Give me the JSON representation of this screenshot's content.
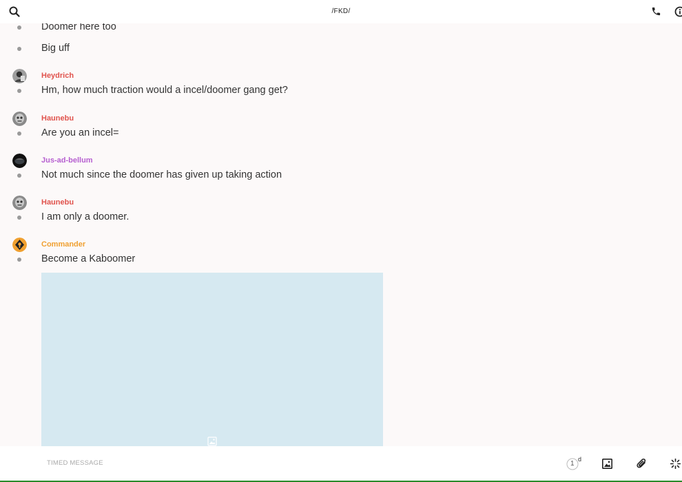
{
  "header": {
    "title": "/FKD/"
  },
  "messages": [
    {
      "author": "",
      "text": "Doomer here too"
    },
    {
      "author": "",
      "text": "Big uff"
    },
    {
      "author": "Heydrich",
      "author_color": "#e0524c",
      "text": "Hm, how much traction would a incel/doomer gang get?"
    },
    {
      "author": "Haunebu",
      "author_color": "#e0524c",
      "text": "Are you an incel="
    },
    {
      "author": "Jus-ad-bellum",
      "author_color": "#b65fd0",
      "text": "Not much since the doomer has given up taking action"
    },
    {
      "author": "Haunebu",
      "author_color": "#e0524c",
      "text": "I am only a doomer."
    },
    {
      "author": "Commander",
      "author_color": "#f0a030",
      "text": "Become a Kaboomer"
    }
  ],
  "composer": {
    "placeholder": "TIMED MESSAGE",
    "timer_value": "1",
    "timer_unit": "d"
  },
  "icons": {
    "search": "search-icon",
    "call": "phone-icon",
    "info": "info-icon",
    "timer": "timer-icon",
    "image": "image-icon",
    "attach": "paperclip-icon",
    "gif": "sparkle-icon"
  }
}
